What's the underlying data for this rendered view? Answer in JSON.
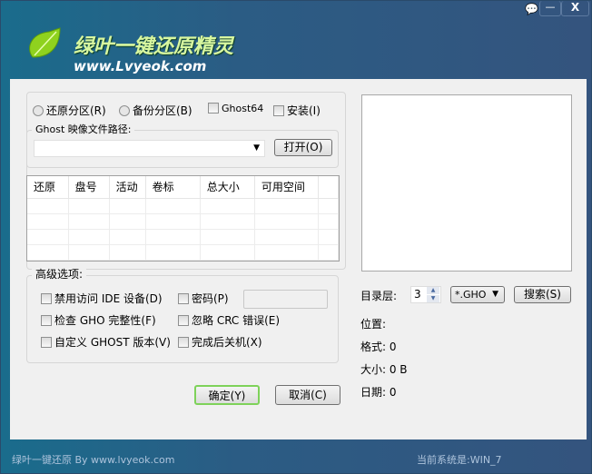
{
  "title": {
    "logo_text": "绿叶一键还原精灵",
    "url": "www.Lvyeok.com"
  },
  "window_controls": {
    "feedback": "feedback-icon",
    "minimize": "—",
    "close": "X"
  },
  "mode": {
    "restore": "还原分区(R)",
    "backup": "备份分区(B)",
    "ghost64": "Ghost64",
    "install": "安装(I)"
  },
  "path": {
    "label": "Ghost 映像文件路径:",
    "value": "",
    "open": "打开(O)"
  },
  "table": {
    "columns": [
      "还原",
      "盘号",
      "活动",
      "卷标",
      "总大小",
      "可用空间",
      ""
    ],
    "rows": [
      [
        "",
        "",
        "",
        "",
        "",
        "",
        ""
      ],
      [
        "",
        "",
        "",
        "",
        "",
        "",
        ""
      ],
      [
        "",
        "",
        "",
        "",
        "",
        "",
        ""
      ],
      [
        "",
        "",
        "",
        "",
        "",
        "",
        ""
      ]
    ]
  },
  "advanced": {
    "label": "高级选项:",
    "disable_ide": "禁用访问 IDE 设备(D)",
    "password": "密码(P)",
    "password_value": "",
    "check_gho": "检查 GHO 完整性(F)",
    "ignore_crc": "忽略 CRC 错误(E)",
    "custom_ghost": "自定义 GHOST 版本(V)",
    "shutdown": "完成后关机(X)"
  },
  "buttons": {
    "ok": "确定(Y)",
    "cancel": "取消(C)"
  },
  "search": {
    "depth_label": "目录层:",
    "depth": "3",
    "filter": "*.GHO",
    "search": "搜索(S)"
  },
  "info": {
    "location": "位置:",
    "format": "格式: 0",
    "size": "大小: 0 B",
    "date": "日期: 0"
  },
  "footer": {
    "left": "绿叶一键还原 By www.lvyeok.com",
    "right": "当前系统是:WIN_7"
  }
}
